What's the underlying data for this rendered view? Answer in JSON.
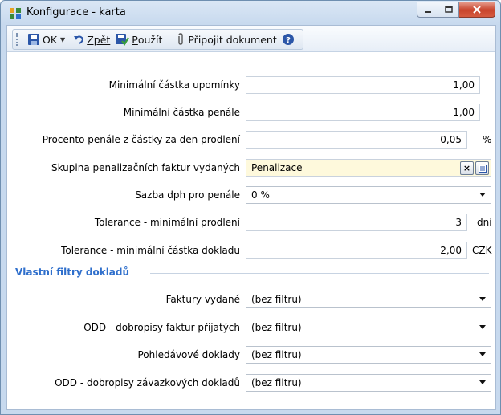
{
  "window": {
    "title": "Konfigurace - karta"
  },
  "toolbar": {
    "ok": "OK",
    "back": "Zpět",
    "apply_u": "P",
    "apply_rest": "oužít",
    "attach": "Připojit dokument"
  },
  "fields": {
    "min_reminder": {
      "label": "Minimální částka upomínky",
      "value": "1,00"
    },
    "min_penalty": {
      "label": "Minimální částka penále",
      "value": "1,00"
    },
    "penalty_percent": {
      "label": "Procento penále z částky za den prodlení",
      "value": "0,05",
      "unit": "%"
    },
    "penalty_group": {
      "label": "Skupina penalizačních faktur vydaných",
      "value": "Penalizace"
    },
    "vat_rate": {
      "label": "Sazba dph pro penále",
      "value": "0 %"
    },
    "tolerance_delay": {
      "label": "Tolerance - minimální prodlení",
      "value": "3",
      "unit": "dní"
    },
    "tolerance_amount": {
      "label": "Tolerance - minimální částka dokladu",
      "value": "2,00",
      "unit": "CZK"
    }
  },
  "filters": {
    "section_title": "Vlastní filtry dokladů",
    "items": [
      {
        "label": "Faktury vydané",
        "value": "(bez filtru)"
      },
      {
        "label": "ODD - dobropisy faktur přijatých",
        "value": "(bez filtru)"
      },
      {
        "label": "Pohledávové doklady",
        "value": "(bez filtru)"
      },
      {
        "label": "ODD - dobropisy závazkových dokladů",
        "value": "(bez filtru)"
      }
    ]
  }
}
